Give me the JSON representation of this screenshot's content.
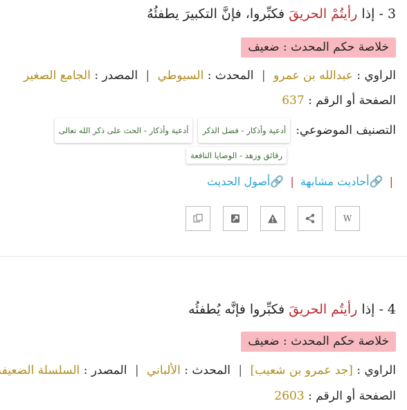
{
  "hadith1": {
    "number": "3 -",
    "pre": "إذا",
    "highlight": "رأيتُمْ الحريقَ",
    "post": "فكبِّروا، فإنَّ التكبيرَ يطفئُهُ",
    "verdict": "خلاصة حكم المحدث : ضعيف",
    "narrator_label": "الراوي :",
    "narrator": "عبدالله بن عمرو",
    "muhaddith_label": "المحدث :",
    "muhaddith": "السيوطي",
    "source_label": "المصدر :",
    "source": "الجامع الصغير",
    "page_label": "الصفحة أو الرقم :",
    "page_number": "637",
    "topic_label": "التصنيف الموضوعي:",
    "tags": [
      "أدعية وأذكار - فضل الذكر",
      "أدعية وأذكار - الحث على ذكر الله تعالى",
      "رقائق وزهد - الوصايا النافعة"
    ],
    "similar_link": "أحاديث مشابهة",
    "usul_link": "أصول الحديث",
    "wiki_label": "W"
  },
  "hadith2": {
    "number": "4 -",
    "pre": "إذا",
    "highlight": "رأيتُم الحريقَ",
    "post": "فكبِّروا فإنَّه يُطفئُه",
    "verdict": "خلاصة حكم المحدث : ضعيف",
    "narrator_label": "الراوي :",
    "narrator": "[جد عمرو بن شعيب]",
    "muhaddith_label": "المحدث :",
    "muhaddith": "الألباني",
    "source_label": "المصدر :",
    "source": "السلسلة الضعيفة",
    "page_label": "الصفحة أو الرقم :",
    "page_number": "2603"
  },
  "separator": "|",
  "colors": {
    "highlight": "#b5272d",
    "verdict_bg": "#f8b9c0",
    "meta_value": "#b08d1e",
    "link": "#2aa3d1",
    "tag_text": "#3b6b33"
  },
  "icons": [
    "copy-icon",
    "expand-icon",
    "warning-icon",
    "share-icon",
    "wiki-icon",
    "link-icon"
  ]
}
